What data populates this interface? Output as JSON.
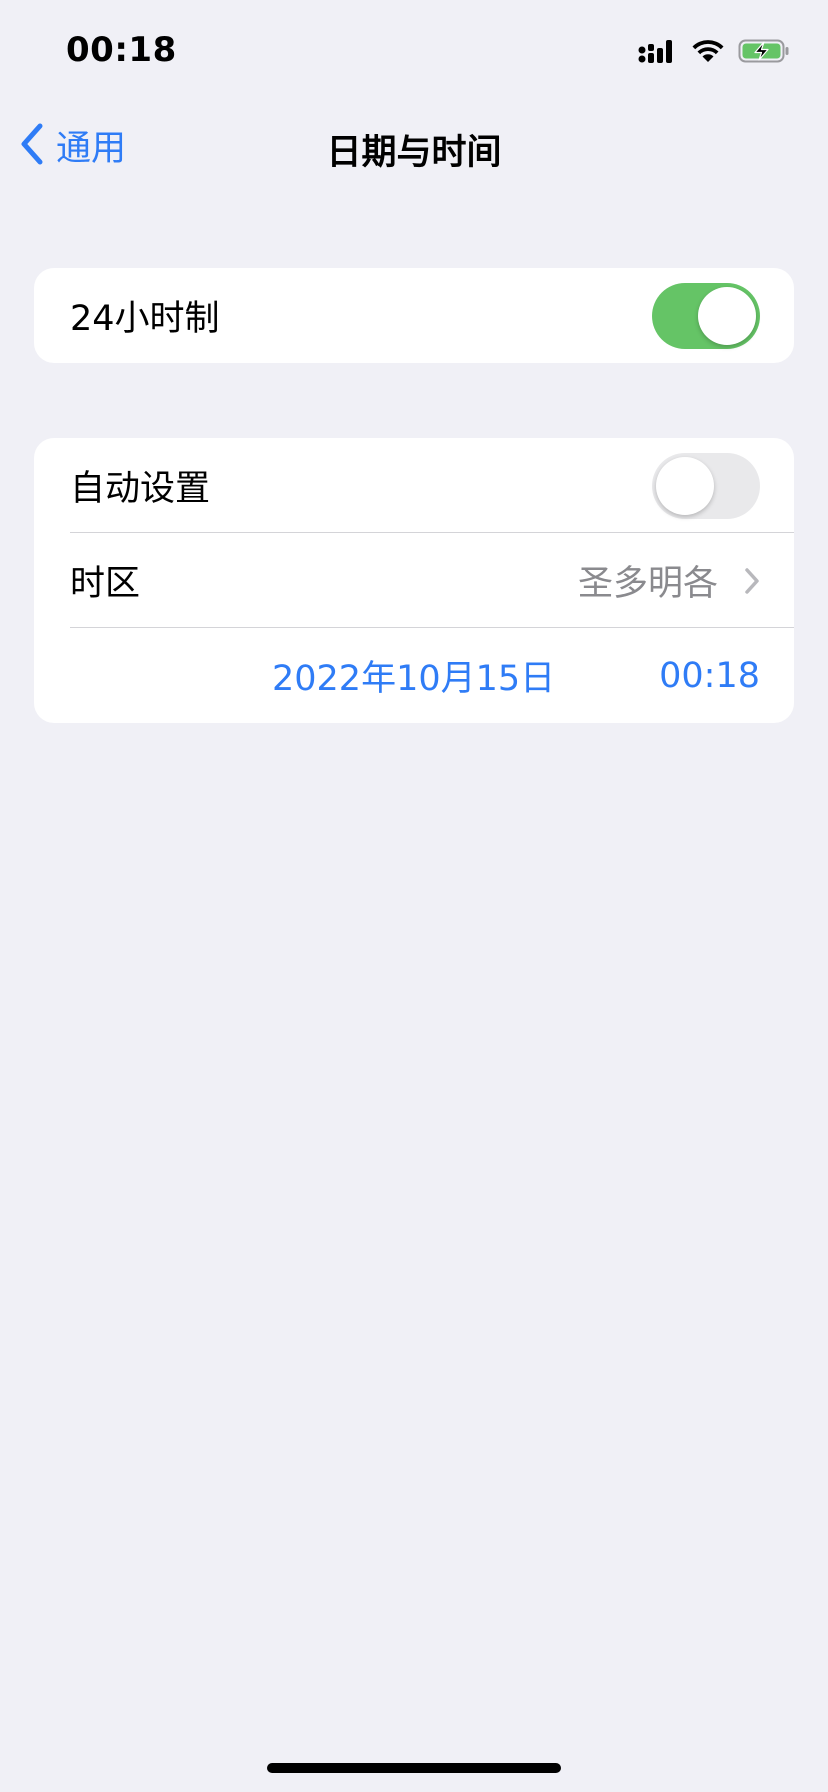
{
  "status_bar": {
    "time": "00:18",
    "icons": [
      "cellular-signal-icon",
      "wifi-icon",
      "battery-charging-icon"
    ]
  },
  "nav": {
    "back_label": "通用",
    "title": "日期与时间"
  },
  "settings": {
    "hour24": {
      "label": "24小时制",
      "enabled": true
    },
    "auto_set": {
      "label": "自动设置",
      "enabled": false
    },
    "timezone": {
      "label": "时区",
      "value": "圣多明各"
    },
    "date": "2022年10月15日",
    "time": "00:18"
  },
  "colors": {
    "accent": "#2f7cf6",
    "toggle_on": "#65c466",
    "toggle_off": "#e9e9eb",
    "background": "#f0f0f6",
    "secondary_text": "#8a8a8e"
  }
}
